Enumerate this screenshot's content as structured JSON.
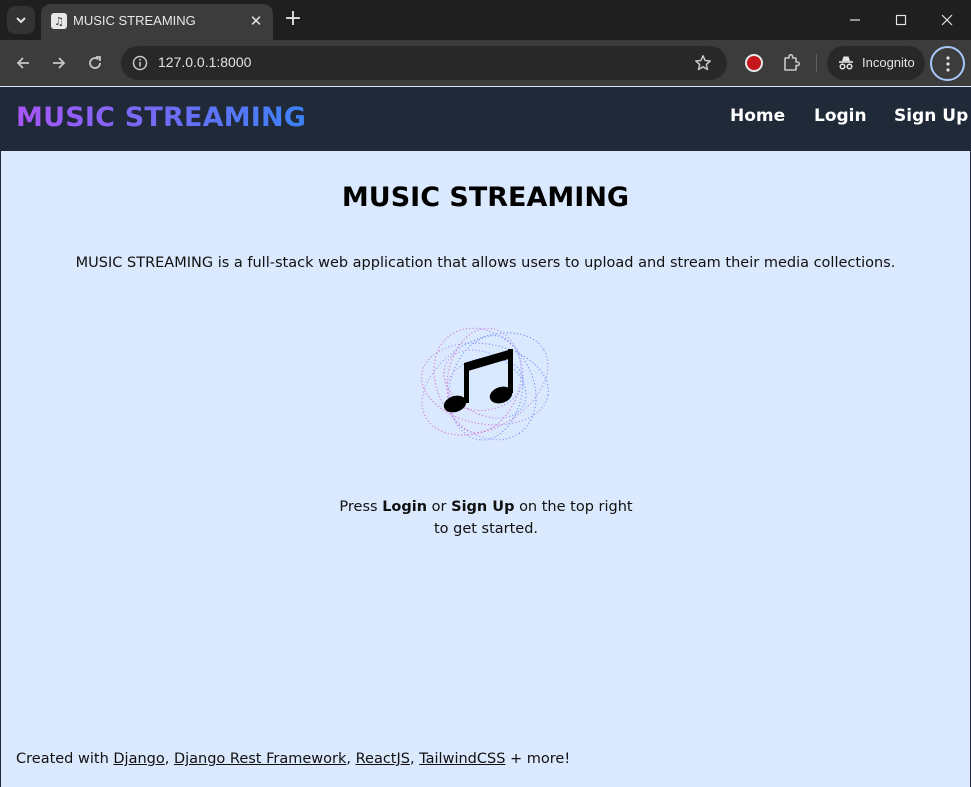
{
  "browser": {
    "tab_title": "MUSIC STREAMING",
    "url": "127.0.0.1:8000",
    "incognito_label": "Incognito"
  },
  "navbar": {
    "brand": "MUSIC STREAMING",
    "links": [
      "Home",
      "Login",
      "Sign Up"
    ]
  },
  "main": {
    "title": "MUSIC STREAMING",
    "description": "MUSIC STREAMING is a full-stack web application that allows users to upload and stream their media collections.",
    "cta": {
      "prefix": "Press",
      "login": "Login",
      "or": "or",
      "signup": "Sign Up",
      "suffix": "on the top right to get started."
    }
  },
  "footer": {
    "prefix": "Created with",
    "links": [
      "Django",
      "Django Rest Framework",
      "ReactJS",
      "TailwindCSS"
    ],
    "suffix": "+ more!"
  },
  "colors": {
    "navbar_bg": "#1f2937",
    "page_bg": "#dbe9fe",
    "brand_gradient_start": "#a855f7",
    "brand_gradient_end": "#3b82f6"
  }
}
